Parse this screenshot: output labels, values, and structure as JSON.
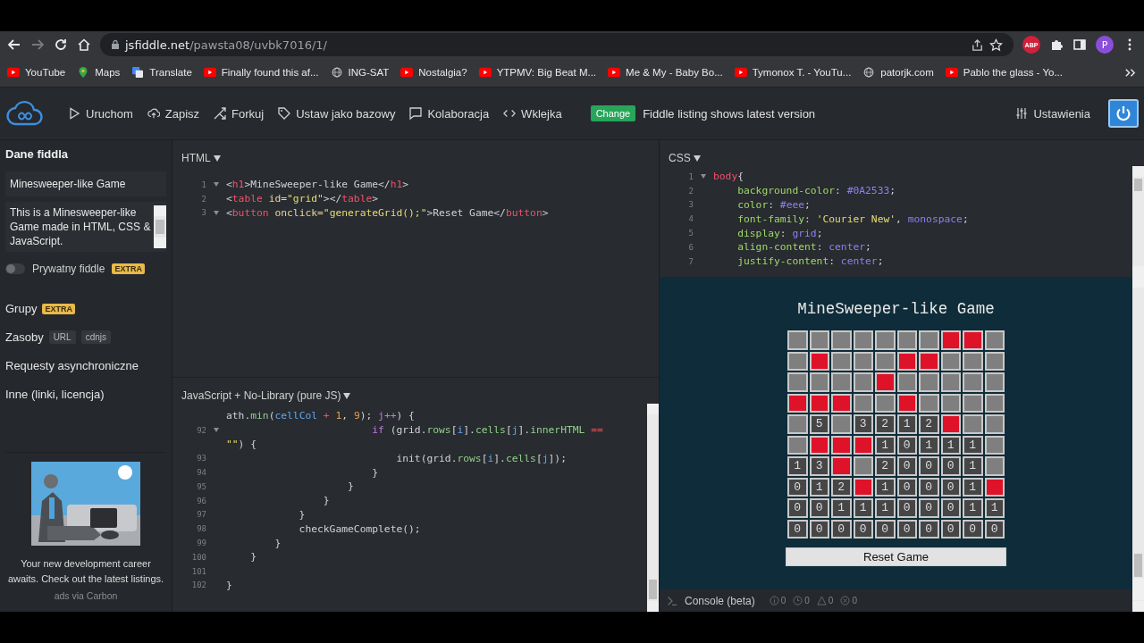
{
  "browser": {
    "url_host": "jsfiddle.net",
    "url_path": "/pawsta08/uvbk7016/1/",
    "forward_disabled": true,
    "extension_label": "ABP",
    "profile_initial": "P",
    "bookmarks": [
      {
        "kind": "youtube",
        "label": "YouTube"
      },
      {
        "kind": "maps",
        "label": "Maps"
      },
      {
        "kind": "translate",
        "label": "Translate"
      },
      {
        "kind": "youtube",
        "label": "Finally found this af..."
      },
      {
        "kind": "globe",
        "label": "ING-SAT"
      },
      {
        "kind": "youtube",
        "label": "Nostalgia?"
      },
      {
        "kind": "youtube",
        "label": "YTPMV: Big Beat M..."
      },
      {
        "kind": "youtube",
        "label": "Me & My - Baby Bo..."
      },
      {
        "kind": "youtube",
        "label": "Tymonox T. - YouTu..."
      },
      {
        "kind": "globe",
        "label": "patorjk.com"
      },
      {
        "kind": "youtube",
        "label": "Pablo the glass - Yo..."
      }
    ]
  },
  "toolbar": {
    "actions": [
      {
        "kind": "run",
        "label": "Uruchom"
      },
      {
        "kind": "save",
        "label": "Zapisz"
      },
      {
        "kind": "fork",
        "label": "Forkuj"
      },
      {
        "kind": "tag",
        "label": "Ustaw jako bazowy"
      },
      {
        "kind": "chat",
        "label": "Kolaboracja"
      },
      {
        "kind": "embed",
        "label": "Wklejka"
      }
    ],
    "change_badge": "Change",
    "change_note": "Fiddle listing shows latest version",
    "settings": "Ustawienia"
  },
  "sidebar": {
    "title": "Dane fiddla",
    "name_value": "Minesweeper-like Game",
    "description_value": "This is a Minesweeper-like Game made in HTML, CSS & JavaScript.",
    "private_toggle": {
      "label": "Prywatny fiddle",
      "on": false,
      "badge": "EXTRA"
    },
    "sections": [
      {
        "label": "Grupy",
        "badges": [
          {
            "kind": "extra",
            "text": "EXTRA"
          }
        ]
      },
      {
        "label": "Zasoby",
        "badges": [
          {
            "kind": "tag",
            "text": "URL"
          },
          {
            "kind": "tag",
            "text": "cdnjs"
          }
        ]
      },
      {
        "label": "Requesty asynchroniczne"
      },
      {
        "label": "Inne (linki, licencja)"
      }
    ],
    "ad": {
      "kind": "picture",
      "text": "Your new development career awaits. Check out the latest listings.",
      "via": "ads via Carbon"
    }
  },
  "html_panel": {
    "title": "HTML",
    "lines": [
      {
        "n": "1",
        "fold": true,
        "segs": [
          {
            "kind": "plain",
            "t": "<"
          },
          {
            "kind": "tag",
            "t": "h1"
          },
          {
            "kind": "plain",
            "t": ">MineSweeper-like Game</"
          },
          {
            "kind": "tag",
            "t": "h1"
          },
          {
            "kind": "plain",
            "t": ">"
          }
        ]
      },
      {
        "n": "2",
        "fold": false,
        "segs": [
          {
            "kind": "plain",
            "t": "<"
          },
          {
            "kind": "tag",
            "t": "table"
          },
          {
            "kind": "attr",
            "t": " id="
          },
          {
            "kind": "str",
            "t": "\"grid\""
          },
          {
            "kind": "plain",
            "t": "></"
          },
          {
            "kind": "tag",
            "t": "table"
          },
          {
            "kind": "plain",
            "t": ">"
          }
        ]
      },
      {
        "n": "3",
        "fold": true,
        "segs": [
          {
            "kind": "plain",
            "t": "<"
          },
          {
            "kind": "tag",
            "t": "button"
          },
          {
            "kind": "attr",
            "t": " onclick="
          },
          {
            "kind": "str",
            "t": "\"generateGrid();\""
          },
          {
            "kind": "plain",
            "t": ">Reset Game</"
          },
          {
            "kind": "tag",
            "t": "button"
          },
          {
            "kind": "plain",
            "t": ">"
          }
        ]
      }
    ]
  },
  "js_panel": {
    "title": "JavaScript + No-Library (pure JS)",
    "lines": [
      {
        "fold": false,
        "segs": [
          {
            "kind": "plain",
            "t": "ath."
          },
          {
            "kind": "fn",
            "t": "min"
          },
          {
            "kind": "plain",
            "t": "("
          },
          {
            "kind": "var",
            "t": "cellCol"
          },
          {
            "kind": "op",
            "t": " + "
          },
          {
            "kind": "num",
            "t": "1"
          },
          {
            "kind": "plain",
            "t": ", "
          },
          {
            "kind": "num",
            "t": "9"
          },
          {
            "kind": "plain",
            "t": "); "
          },
          {
            "kind": "kw",
            "t": "j++"
          },
          {
            "kind": "plain",
            "t": ") {"
          }
        ]
      },
      {
        "n": "92",
        "fold": true,
        "segs": [
          {
            "kind": "kw",
            "t": "                        if"
          },
          {
            "kind": "plain",
            "t": " (grid."
          },
          {
            "kind": "fn",
            "t": "rows"
          },
          {
            "kind": "plain",
            "t": "["
          },
          {
            "kind": "var",
            "t": "i"
          },
          {
            "kind": "plain",
            "t": "]."
          },
          {
            "kind": "fn",
            "t": "cells"
          },
          {
            "kind": "plain",
            "t": "["
          },
          {
            "kind": "var",
            "t": "j"
          },
          {
            "kind": "plain",
            "t": "]."
          },
          {
            "kind": "fn",
            "t": "innerHTML"
          },
          {
            "kind": "op",
            "t": " =="
          }
        ]
      },
      {
        "fold": false,
        "segs": [
          {
            "kind": "str",
            "t": "\"\""
          },
          {
            "kind": "plain",
            "t": ") {"
          }
        ]
      },
      {
        "n": "93",
        "fold": false,
        "segs": [
          {
            "kind": "plain",
            "t": "                            init(grid."
          },
          {
            "kind": "fn",
            "t": "rows"
          },
          {
            "kind": "plain",
            "t": "["
          },
          {
            "kind": "var",
            "t": "i"
          },
          {
            "kind": "plain",
            "t": "]."
          },
          {
            "kind": "fn",
            "t": "cells"
          },
          {
            "kind": "plain",
            "t": "["
          },
          {
            "kind": "var",
            "t": "j"
          },
          {
            "kind": "plain",
            "t": "]);"
          }
        ]
      },
      {
        "n": "94",
        "fold": false,
        "segs": [
          {
            "kind": "plain",
            "t": "                        }"
          }
        ]
      },
      {
        "n": "95",
        "fold": false,
        "segs": [
          {
            "kind": "plain",
            "t": "                    }"
          }
        ]
      },
      {
        "n": "96",
        "fold": false,
        "segs": [
          {
            "kind": "plain",
            "t": "                }"
          }
        ]
      },
      {
        "n": "97",
        "fold": false,
        "segs": [
          {
            "kind": "plain",
            "t": "            }"
          }
        ]
      },
      {
        "n": "98",
        "fold": false,
        "segs": [
          {
            "kind": "plain",
            "t": "            checkGameComplete();"
          }
        ]
      },
      {
        "n": "99",
        "fold": false,
        "segs": [
          {
            "kind": "plain",
            "t": "        }"
          }
        ]
      },
      {
        "n": "100",
        "fold": false,
        "segs": [
          {
            "kind": "plain",
            "t": "    }"
          }
        ]
      },
      {
        "n": "101",
        "fold": false
      },
      {
        "n": "102",
        "fold": false,
        "segs": [
          {
            "kind": "plain",
            "t": "}"
          }
        ]
      }
    ]
  },
  "css_panel": {
    "title": "CSS",
    "lines": [
      {
        "n": "1",
        "fold": true,
        "segs": [
          {
            "kind": "tag",
            "t": "body"
          },
          {
            "kind": "plain",
            "t": "{"
          }
        ]
      },
      {
        "n": "2",
        "fold": false,
        "segs": [
          {
            "kind": "prop",
            "t": "    background-color"
          },
          {
            "kind": "plain",
            "t": ": "
          },
          {
            "kind": "val",
            "t": "#0A2533"
          },
          {
            "kind": "plain",
            "t": ";"
          }
        ]
      },
      {
        "n": "3",
        "fold": false,
        "segs": [
          {
            "kind": "prop",
            "t": "    color"
          },
          {
            "kind": "plain",
            "t": ": "
          },
          {
            "kind": "val",
            "t": "#eee"
          },
          {
            "kind": "plain",
            "t": ";"
          }
        ]
      },
      {
        "n": "4",
        "fold": false,
        "segs": [
          {
            "kind": "prop",
            "t": "    font-family"
          },
          {
            "kind": "plain",
            "t": ": "
          },
          {
            "kind": "str",
            "t": "'Courier New'"
          },
          {
            "kind": "plain",
            "t": ", "
          },
          {
            "kind": "val",
            "t": "monospace"
          },
          {
            "kind": "plain",
            "t": ";"
          }
        ]
      },
      {
        "n": "5",
        "fold": false,
        "segs": [
          {
            "kind": "prop",
            "t": "    display"
          },
          {
            "kind": "plain",
            "t": ": "
          },
          {
            "kind": "val",
            "t": "grid"
          },
          {
            "kind": "plain",
            "t": ";"
          }
        ]
      },
      {
        "n": "6",
        "fold": false,
        "segs": [
          {
            "kind": "prop",
            "t": "    align-content"
          },
          {
            "kind": "plain",
            "t": ": "
          },
          {
            "kind": "val",
            "t": "center"
          },
          {
            "kind": "plain",
            "t": ";"
          }
        ]
      },
      {
        "n": "7",
        "fold": false,
        "segs": [
          {
            "kind": "prop",
            "t": "    justify-content"
          },
          {
            "kind": "plain",
            "t": ": "
          },
          {
            "kind": "val",
            "t": "center"
          },
          {
            "kind": "plain",
            "t": ";"
          }
        ]
      }
    ]
  },
  "result": {
    "title": "MineSweeper-like Game",
    "grid": [
      [
        {
          "kind": "hidden"
        },
        {
          "kind": "hidden"
        },
        {
          "kind": "hidden"
        },
        {
          "kind": "hidden"
        },
        {
          "kind": "hidden"
        },
        {
          "kind": "hidden"
        },
        {
          "kind": "hidden"
        },
        {
          "kind": "mine"
        },
        {
          "kind": "mine"
        },
        {
          "kind": "hidden"
        }
      ],
      [
        {
          "kind": "hidden"
        },
        {
          "kind": "mine"
        },
        {
          "kind": "hidden"
        },
        {
          "kind": "hidden"
        },
        {
          "kind": "hidden"
        },
        {
          "kind": "mine"
        },
        {
          "kind": "mine"
        },
        {
          "kind": "hidden"
        },
        {
          "kind": "hidden"
        },
        {
          "kind": "hidden"
        }
      ],
      [
        {
          "kind": "hidden"
        },
        {
          "kind": "hidden"
        },
        {
          "kind": "hidden"
        },
        {
          "kind": "hidden"
        },
        {
          "kind": "mine"
        },
        {
          "kind": "hidden"
        },
        {
          "kind": "hidden"
        },
        {
          "kind": "hidden"
        },
        {
          "kind": "hidden"
        },
        {
          "kind": "hidden"
        }
      ],
      [
        {
          "kind": "mine"
        },
        {
          "kind": "mine"
        },
        {
          "kind": "mine"
        },
        {
          "kind": "hidden"
        },
        {
          "kind": "hidden"
        },
        {
          "kind": "mine"
        },
        {
          "kind": "hidden"
        },
        {
          "kind": "hidden"
        },
        {
          "kind": "hidden"
        },
        {
          "kind": "hidden"
        }
      ],
      [
        {
          "kind": "hidden"
        },
        {
          "kind": "open",
          "text": "5"
        },
        {
          "kind": "hidden"
        },
        {
          "kind": "open",
          "text": "3"
        },
        {
          "kind": "open",
          "text": "2"
        },
        {
          "kind": "open",
          "text": "1"
        },
        {
          "kind": "open",
          "text": "2"
        },
        {
          "kind": "mine"
        },
        {
          "kind": "hidden"
        },
        {
          "kind": "hidden"
        }
      ],
      [
        {
          "kind": "hidden"
        },
        {
          "kind": "mine"
        },
        {
          "kind": "mine"
        },
        {
          "kind": "mine"
        },
        {
          "kind": "open",
          "text": "1"
        },
        {
          "kind": "open",
          "text": "0"
        },
        {
          "kind": "open",
          "text": "1"
        },
        {
          "kind": "open",
          "text": "1"
        },
        {
          "kind": "open",
          "text": "1"
        },
        {
          "kind": "hidden"
        }
      ],
      [
        {
          "kind": "open",
          "text": "1"
        },
        {
          "kind": "open",
          "text": "3"
        },
        {
          "kind": "mine"
        },
        {
          "kind": "hidden"
        },
        {
          "kind": "open",
          "text": "2"
        },
        {
          "kind": "open",
          "text": "0"
        },
        {
          "kind": "open",
          "text": "0"
        },
        {
          "kind": "open",
          "text": "0"
        },
        {
          "kind": "open",
          "text": "1"
        },
        {
          "kind": "hidden"
        }
      ],
      [
        {
          "kind": "open",
          "text": "0"
        },
        {
          "kind": "open",
          "text": "1"
        },
        {
          "kind": "open",
          "text": "2"
        },
        {
          "kind": "mine"
        },
        {
          "kind": "open",
          "text": "1"
        },
        {
          "kind": "open",
          "text": "0"
        },
        {
          "kind": "open",
          "text": "0"
        },
        {
          "kind": "open",
          "text": "0"
        },
        {
          "kind": "open",
          "text": "1"
        },
        {
          "kind": "mine"
        }
      ],
      [
        {
          "kind": "open",
          "text": "0"
        },
        {
          "kind": "open",
          "text": "0"
        },
        {
          "kind": "open",
          "text": "1"
        },
        {
          "kind": "open",
          "text": "1"
        },
        {
          "kind": "open",
          "text": "1"
        },
        {
          "kind": "open",
          "text": "0"
        },
        {
          "kind": "open",
          "text": "0"
        },
        {
          "kind": "open",
          "text": "0"
        },
        {
          "kind": "open",
          "text": "1"
        },
        {
          "kind": "open",
          "text": "1"
        }
      ],
      [
        {
          "kind": "open",
          "text": "0"
        },
        {
          "kind": "open",
          "text": "0"
        },
        {
          "kind": "open",
          "text": "0"
        },
        {
          "kind": "open",
          "text": "0"
        },
        {
          "kind": "open",
          "text": "0"
        },
        {
          "kind": "open",
          "text": "0"
        },
        {
          "kind": "open",
          "text": "0"
        },
        {
          "kind": "open",
          "text": "0"
        },
        {
          "kind": "open",
          "text": "0"
        },
        {
          "kind": "open",
          "text": "0"
        }
      ]
    ],
    "reset_button": "Reset Game"
  },
  "console": {
    "label": "Console (beta)",
    "counters": [
      {
        "kind": "info",
        "count": "0"
      },
      {
        "kind": "log",
        "count": "0"
      },
      {
        "kind": "warn",
        "count": "0"
      },
      {
        "kind": "error",
        "count": "0"
      }
    ]
  }
}
